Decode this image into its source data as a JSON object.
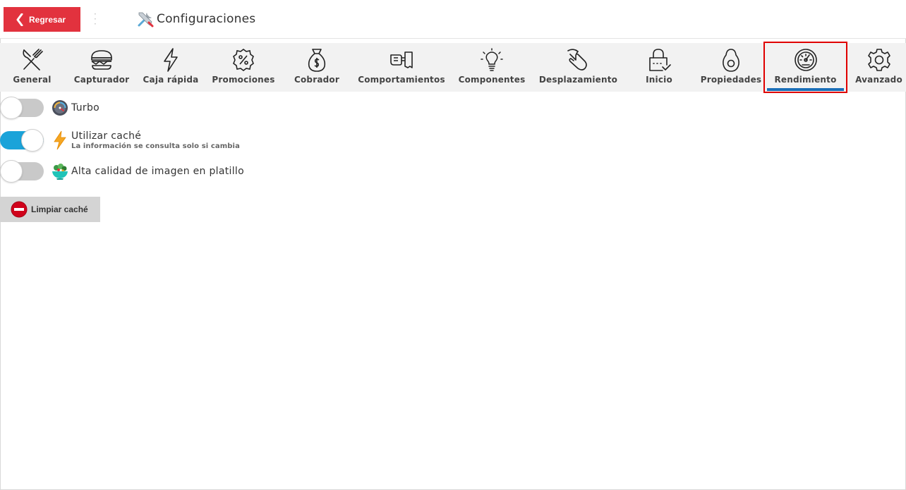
{
  "header": {
    "back_label": "Regresar",
    "title": "Configuraciones"
  },
  "tabs": [
    {
      "label": "General",
      "icon": "utensils-icon"
    },
    {
      "label": "Capturador",
      "icon": "burger-icon"
    },
    {
      "label": "Caja rápida",
      "icon": "lightning-icon"
    },
    {
      "label": "Promociones",
      "icon": "percent-badge-icon"
    },
    {
      "label": "Cobrador",
      "icon": "money-bag-icon"
    },
    {
      "label": "Comportamientos",
      "icon": "hand-receipt-icon"
    },
    {
      "label": "Componentes",
      "icon": "lightbulb-icon"
    },
    {
      "label": "Desplazamiento",
      "icon": "swipe-hand-icon"
    },
    {
      "label": "Inicio",
      "icon": "lock-check-icon"
    },
    {
      "label": "Propiedades",
      "icon": "avocado-icon"
    },
    {
      "label": "Rendimiento",
      "icon": "speedometer-icon",
      "active": true
    },
    {
      "label": "Avanzado",
      "icon": "gear-icon"
    }
  ],
  "settings": [
    {
      "label": "Turbo",
      "subtitle": "",
      "enabled": false,
      "icon": "turbo-gauge-icon"
    },
    {
      "label": "Utilizar caché",
      "subtitle": "La información se consulta solo si cambia",
      "enabled": true,
      "icon": "lightning-bolt-icon"
    },
    {
      "label": "Alta calidad de imagen en platillo",
      "subtitle": "",
      "enabled": false,
      "icon": "salad-bowl-icon"
    }
  ],
  "clear_cache": {
    "label": "Limpiar caché"
  },
  "colors": {
    "accent_red": "#e2323e",
    "toggle_on": "#1aa3d9",
    "active_tab_border": "#e00000",
    "active_tab_underline": "#1a6fb8"
  }
}
